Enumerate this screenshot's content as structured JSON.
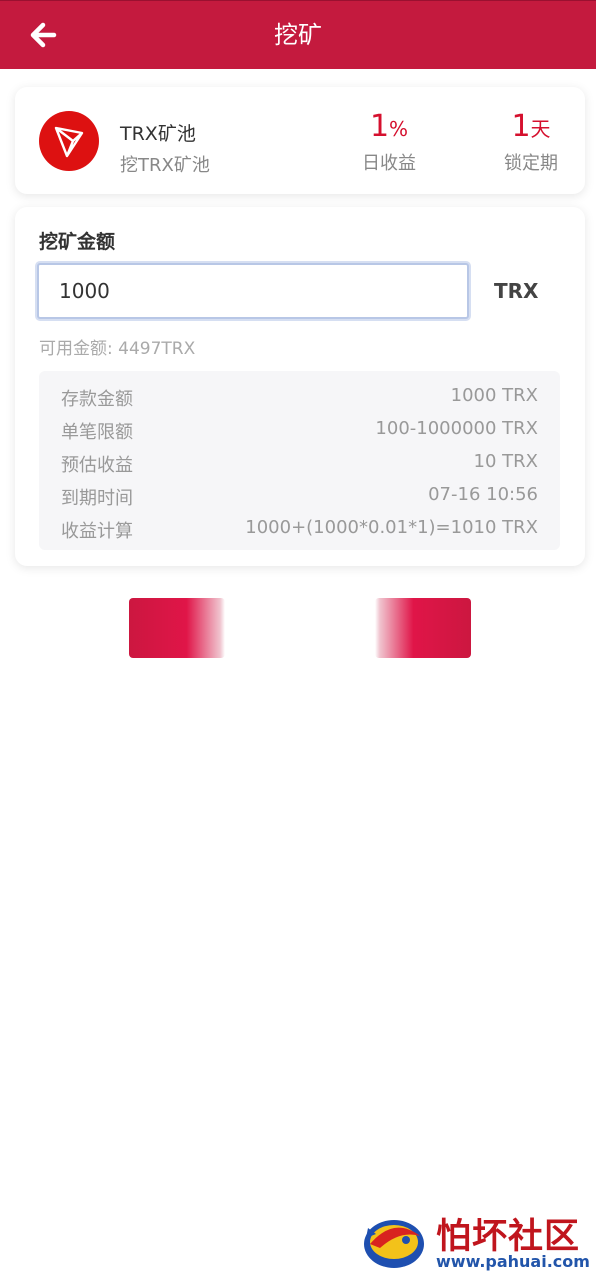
{
  "header": {
    "title": "挖矿",
    "back_icon": "arrow-left-icon"
  },
  "pool": {
    "logo_icon": "tron-logo-icon",
    "name": "TRX矿池",
    "subtitle": "挖TRX矿池",
    "daily_rate_value": "1",
    "daily_rate_unit": "%",
    "daily_rate_label": "日收益",
    "lock_value": "1",
    "lock_unit": "天",
    "lock_label": "锁定期"
  },
  "form": {
    "title": "挖矿金额",
    "amount_value": "1000",
    "currency": "TRX",
    "available": "可用金额: 4497TRX"
  },
  "details": [
    {
      "key": "存款金额",
      "value": "1000 TRX"
    },
    {
      "key": "单笔限额",
      "value": "100-1000000 TRX"
    },
    {
      "key": "预估收益",
      "value": "10 TRX"
    },
    {
      "key": "到期时间",
      "value": "07-16 10:56"
    },
    {
      "key": "收益计算",
      "value": "1000+(1000*0.01*1)=1010 TRX"
    }
  ],
  "watermark": {
    "title": "怕坏社区",
    "url": "www.pahuai.com"
  },
  "colors": {
    "brand": "#c41a3e",
    "accent": "#d5102e"
  }
}
